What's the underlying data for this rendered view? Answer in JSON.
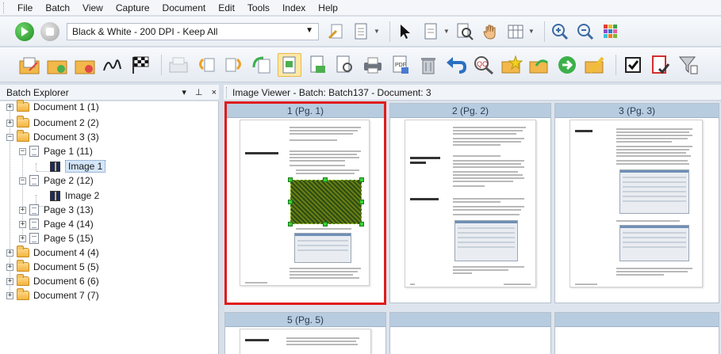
{
  "menu": [
    "File",
    "Batch",
    "View",
    "Capture",
    "Document",
    "Edit",
    "Tools",
    "Index",
    "Help"
  ],
  "toolbar": {
    "profile_value": "Black & White - 200 DPI - Keep All"
  },
  "explorer": {
    "title": "Batch Explorer",
    "controls": "▾ &#x2B7; ×",
    "tree": [
      {
        "label": "Document 1 (1)",
        "level": 0,
        "type": "folder",
        "expander": "+"
      },
      {
        "label": "Document 2 (2)",
        "level": 0,
        "type": "folder",
        "expander": "+"
      },
      {
        "label": "Document 3 (3)",
        "level": 0,
        "type": "folder",
        "expander": "−"
      },
      {
        "label": "Page 1 (11)",
        "level": 1,
        "type": "page",
        "expander": "−"
      },
      {
        "label": "Image 1",
        "level": 2,
        "type": "image",
        "expander": "",
        "selected": true
      },
      {
        "label": "Page 2 (12)",
        "level": 1,
        "type": "page",
        "expander": "−"
      },
      {
        "label": "Image 2",
        "level": 2,
        "type": "image",
        "expander": ""
      },
      {
        "label": "Page 3 (13)",
        "level": 1,
        "type": "page",
        "expander": "+"
      },
      {
        "label": "Page 4 (14)",
        "level": 1,
        "type": "page",
        "expander": "+"
      },
      {
        "label": "Page 5 (15)",
        "level": 1,
        "type": "page",
        "expander": "+"
      },
      {
        "label": "Document 4 (4)",
        "level": 0,
        "type": "folder",
        "expander": "+"
      },
      {
        "label": "Document 5 (5)",
        "level": 0,
        "type": "folder",
        "expander": "+"
      },
      {
        "label": "Document 6 (6)",
        "level": 0,
        "type": "folder",
        "expander": "+"
      },
      {
        "label": "Document 7 (7)",
        "level": 0,
        "type": "folder",
        "expander": "+"
      }
    ]
  },
  "viewer": {
    "title": "Image Viewer - Batch: Batch137 - Document: 3",
    "thumbnails": [
      {
        "caption": "1 (Pg. 1)",
        "selected": true
      },
      {
        "caption": "2 (Pg. 2)",
        "selected": false
      },
      {
        "caption": "3 (Pg. 3)",
        "selected": false
      },
      {
        "caption": "5 (Pg. 5)",
        "selected": false
      },
      {
        "caption": "",
        "selected": false
      },
      {
        "caption": "",
        "selected": false
      }
    ],
    "page_text": {
      "p1_heading": "Creating a new batch",
      "p2_heading1": "Opening an existing batch",
      "p2_heading2": "Deleting a batch",
      "p3_heading": "Using a job",
      "p5_heading": "Editing options"
    }
  },
  "colors": {
    "selection_border": "#e01b1b",
    "caption_bg": "#b8cce0",
    "tree_selection": "#d4e6fa"
  }
}
